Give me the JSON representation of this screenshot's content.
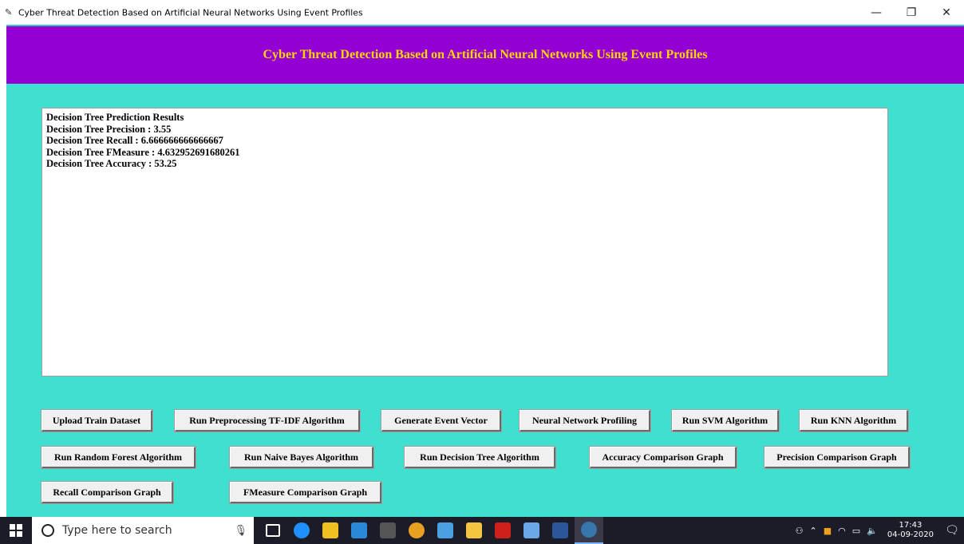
{
  "window": {
    "title": "Cyber Threat Detection Based on Artificial Neural Networks Using Event Profiles",
    "minimize_icon": "minimize-icon",
    "maximize_icon": "restore-icon",
    "close_icon": "close-icon"
  },
  "header": {
    "heading": "Cyber Threat Detection Based on Artificial Neural Networks Using Event Profiles",
    "bg_color": "#9400d3",
    "text_color": "#ffd700"
  },
  "main": {
    "bg_color": "#40e0d0"
  },
  "output": {
    "lines": [
      "Decision Tree Prediction Results",
      "Decision Tree Precision : 3.55",
      "Decision Tree Recall : 6.666666666666667",
      "Decision Tree FMeasure : 4.632952691680261",
      "Decision Tree Accuracy : 53.25"
    ]
  },
  "buttons": {
    "upload_train": "Upload Train Dataset",
    "preprocessing": "Run Preprocessing TF-IDF Algorithm",
    "event_vector": "Generate Event Vector",
    "nn_profiling": "Neural Network Profiling",
    "svm": "Run SVM Algorithm",
    "knn": "Run KNN Algorithm",
    "random_forest": "Run Random Forest Algorithm",
    "naive_bayes": "Run Naive Bayes Algorithm",
    "decision_tree": "Run Decision Tree Algorithm",
    "accuracy_graph": "Accuracy Comparison Graph",
    "precision_graph": "Precision Comparison Graph",
    "recall_graph": "Recall Comparison Graph",
    "fmeasure_graph": "FMeasure Comparison Graph"
  },
  "taskbar": {
    "search_placeholder": "Type here to search",
    "time": "17:43",
    "date": "04-09-2020"
  }
}
